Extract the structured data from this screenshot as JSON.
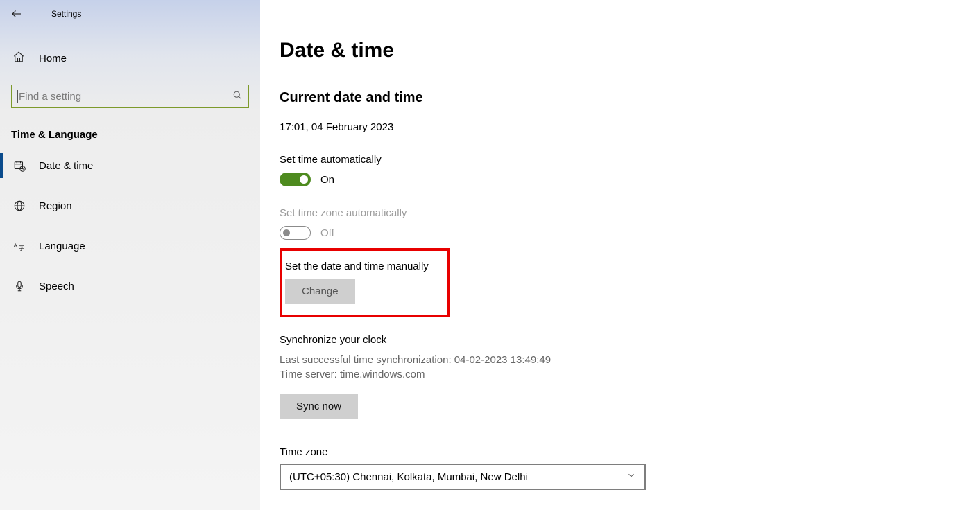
{
  "titlebar": {
    "title": "Settings"
  },
  "sidebar": {
    "home": "Home",
    "search_placeholder": "Find a setting",
    "group": "Time & Language",
    "items": [
      {
        "label": "Date & time"
      },
      {
        "label": "Region"
      },
      {
        "label": "Language"
      },
      {
        "label": "Speech"
      }
    ]
  },
  "page": {
    "title": "Date & time",
    "current_heading": "Current date and time",
    "current_value": "17:01, 04 February 2023",
    "auto_time_label": "Set time automatically",
    "auto_time_state": "On",
    "auto_tz_label": "Set time zone automatically",
    "auto_tz_state": "Off",
    "manual_label": "Set the date and time manually",
    "change_btn": "Change",
    "sync_heading": "Synchronize your clock",
    "sync_last": "Last successful time synchronization: 04-02-2023 13:49:49",
    "sync_server": "Time server: time.windows.com",
    "sync_btn": "Sync now",
    "tz_heading": "Time zone",
    "tz_value": "(UTC+05:30) Chennai, Kolkata, Mumbai, New Delhi"
  }
}
